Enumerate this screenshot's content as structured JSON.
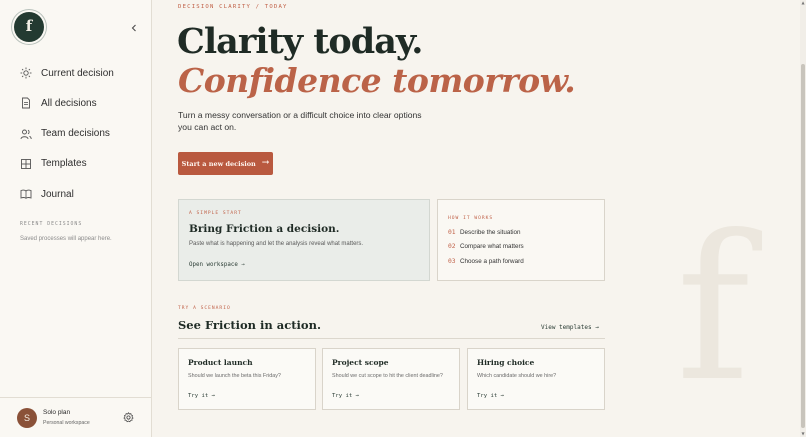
{
  "sidebar": {
    "logo_letter": "f",
    "nav": [
      {
        "label": "Current decision",
        "icon": "sun-icon"
      },
      {
        "label": "All decisions",
        "icon": "document-icon"
      },
      {
        "label": "Team decisions",
        "icon": "people-icon"
      },
      {
        "label": "Templates",
        "icon": "grid-icon"
      },
      {
        "label": "Journal",
        "icon": "book-icon"
      }
    ],
    "recent_heading": "RECENT DECISIONS",
    "recent_empty": "Saved processes will appear here.",
    "footer": {
      "avatar_letter": "S",
      "plan": "Solo plan",
      "workspace": "Personal workspace"
    }
  },
  "main": {
    "eyebrow": "DECISION CLARITY / TODAY",
    "headline_line1": "Clarity today.",
    "headline_line2": "Confidence tomorrow.",
    "subtitle": "Turn a messy conversation or a difficult choice into clear options you can act on.",
    "cta_label": "Start a new decision",
    "start_card": {
      "eyebrow": "A SIMPLE START",
      "title": "Bring Friction a decision.",
      "description": "Paste what is happening and let the analysis reveal what matters.",
      "link": "Open workspace"
    },
    "how_card": {
      "eyebrow": "HOW IT WORKS",
      "steps": [
        {
          "num": "01",
          "text": "Describe the situation"
        },
        {
          "num": "02",
          "text": "Compare what matters"
        },
        {
          "num": "03",
          "text": "Choose a path forward"
        }
      ]
    },
    "scenarios_eyebrow": "TRY A SCENARIO",
    "scenarios_title": "See Friction in action.",
    "view_templates": "View templates",
    "scenarios": [
      {
        "title": "Product launch",
        "question": "Should we launch the beta this Friday?",
        "try": "Try it"
      },
      {
        "title": "Project scope",
        "question": "Should we cut scope to hit the client deadline?",
        "try": "Try it"
      },
      {
        "title": "Hiring choice",
        "question": "Which candidate should we hire?",
        "try": "Try it"
      }
    ],
    "watermark": "f"
  },
  "colors": {
    "accent": "#b9593f",
    "ink": "#1f2b25",
    "background": "#f7f4ee"
  }
}
